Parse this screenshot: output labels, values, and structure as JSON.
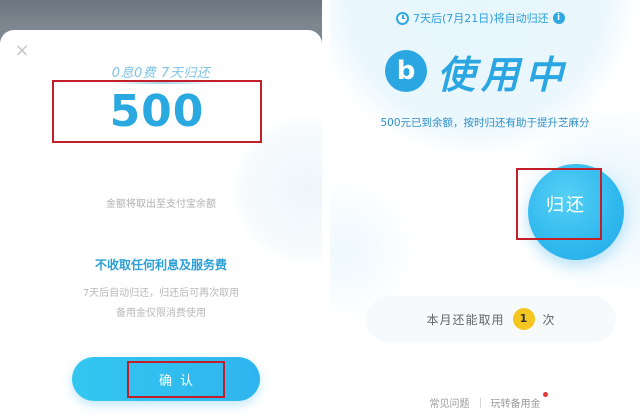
{
  "left": {
    "close_icon": "×",
    "slogan": "0息0费 7天归还",
    "amount": "500",
    "amount_desc": "金额将取出至支付宝余额",
    "no_fee": "不收取任何利息及服务费",
    "rule_line1": "7天后自动归还，归还后可再次取用",
    "rule_line2": "备用金仅限消费使用",
    "confirm_label": "确认"
  },
  "right": {
    "timer_text": "7天后(7月21日)将自动归还",
    "info_icon": "i",
    "brand_logo": "b",
    "brand_title": "使用中",
    "balance_note": "500元已到余额，按时归还有助于提升芝麻分",
    "return_label": "归还",
    "usage_prefix": "本月还能取用",
    "usage_count": "1",
    "usage_suffix": "次",
    "footer": {
      "faq": "常见问题",
      "guide": "玩转备用金"
    }
  },
  "colors": {
    "accent": "#2aa6e2",
    "highlight_box": "#c21f2a",
    "badge": "#f5c61f"
  }
}
